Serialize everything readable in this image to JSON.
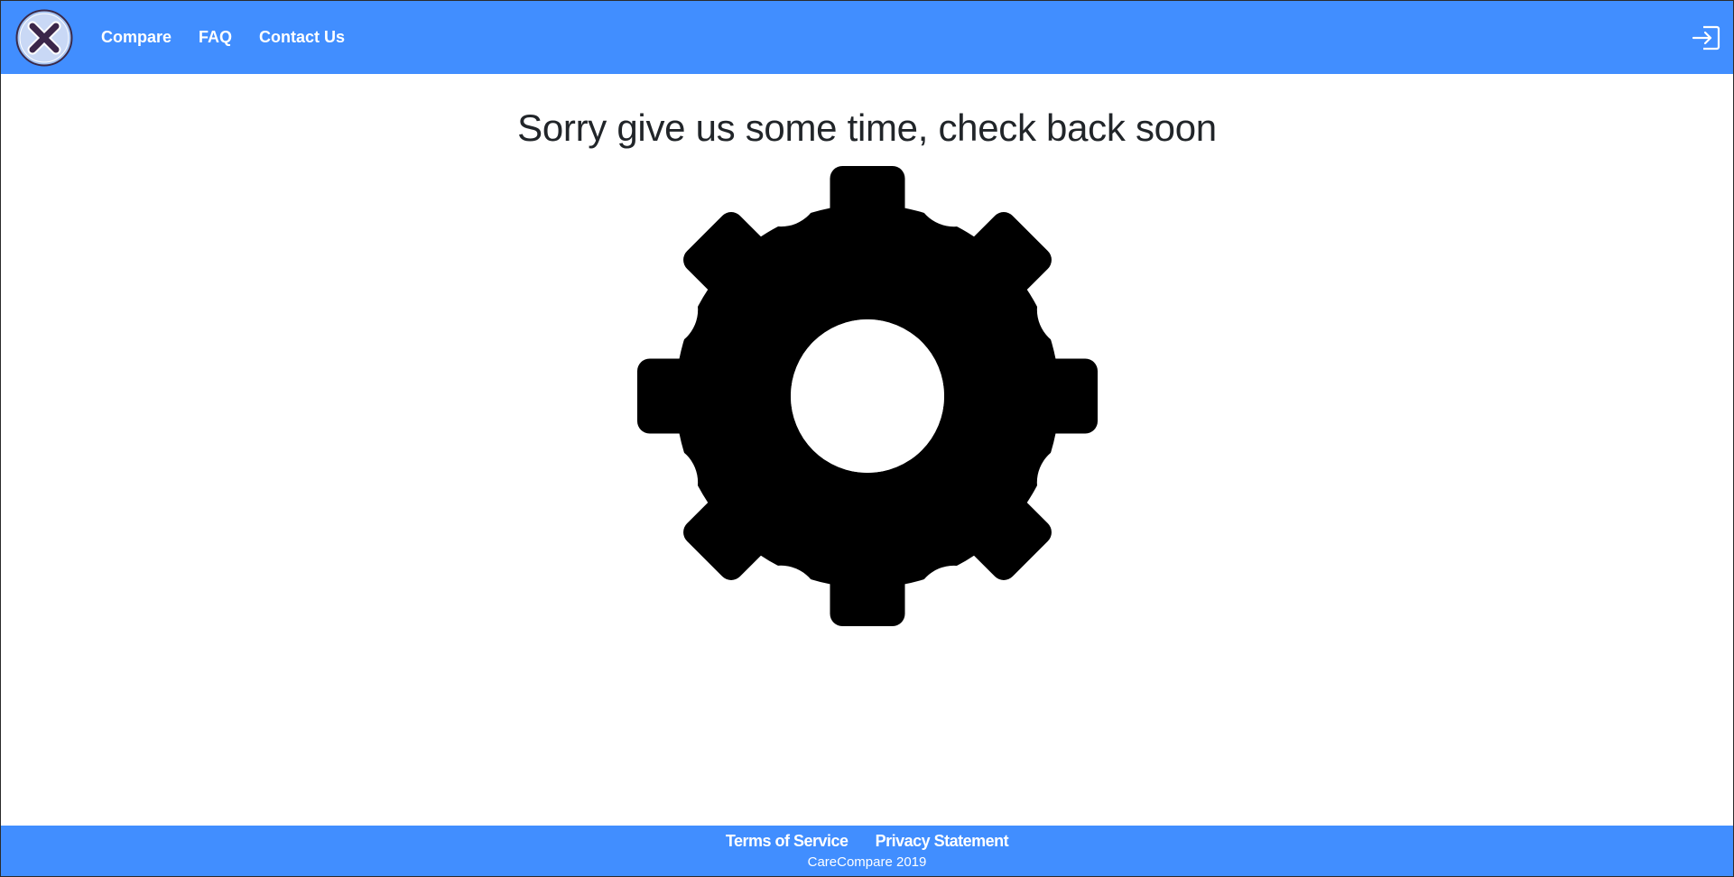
{
  "header": {
    "background_color": "#418eff",
    "logo_icon": "close-x-logo-icon",
    "nav": [
      {
        "label": "Compare"
      },
      {
        "label": "FAQ"
      },
      {
        "label": "Contact Us"
      }
    ],
    "login_icon": "sign-in-icon"
  },
  "main": {
    "heading": "Sorry give us some time, check back soon",
    "illustration_icon": "gear-icon"
  },
  "footer": {
    "background_color": "#418eff",
    "links": [
      {
        "label": "Terms of Service"
      },
      {
        "label": "Privacy Statement"
      }
    ],
    "copyright": "CareCompare 2019"
  }
}
